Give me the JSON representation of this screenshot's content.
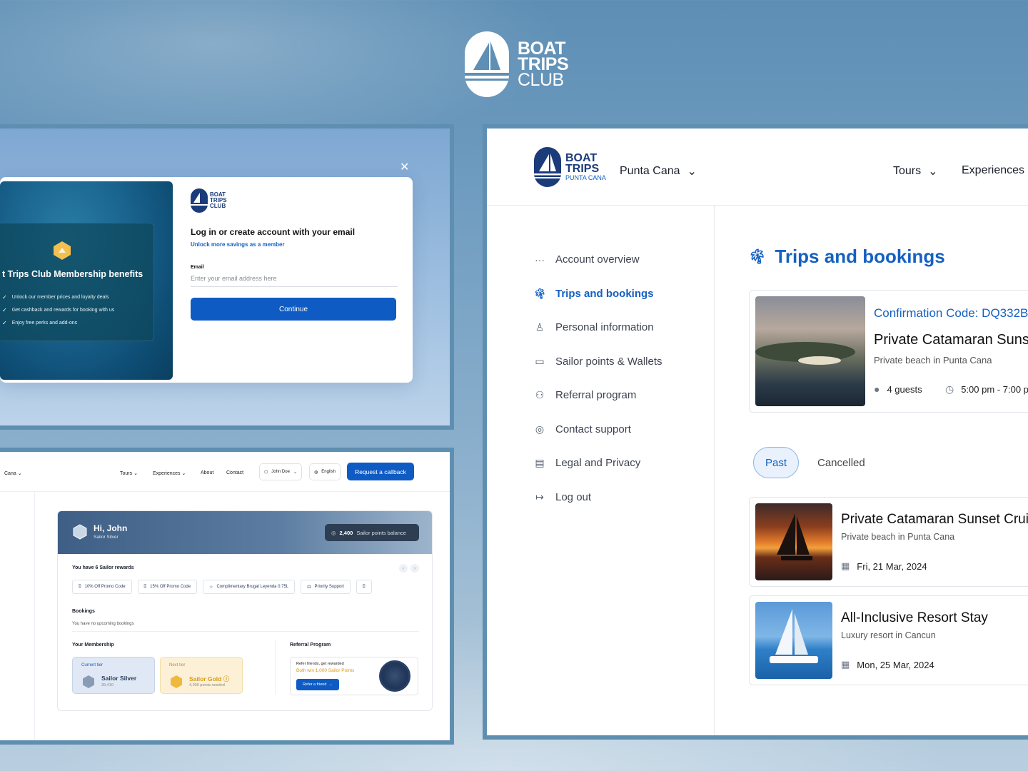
{
  "brand": {
    "hero_line1": "BOAT",
    "hero_line2": "TRIPS",
    "hero_line3": "CLUB",
    "colors": {
      "primary": "#0f5bc4",
      "navy": "#1b3b7a",
      "accent_gold": "#d99a17"
    }
  },
  "login_panel": {
    "close_icon": "close-icon",
    "logo": [
      "BOAT",
      "TRIPS",
      "CLUB"
    ],
    "benefits_title": "t Trips Club Membership benefits",
    "benefits": [
      "Unlock our member prices and loyalty deals",
      "Get cashback and rewards for booking with us",
      "Enjoy free perks and add-ons"
    ],
    "heading": "Log in or create account with your email",
    "subheading": "Unlock more savings as a member",
    "email_label": "Email",
    "email_placeholder": "Enter your email address here",
    "continue_label": "Continue"
  },
  "dashboard_panel": {
    "location": "Cana",
    "nav": {
      "tours": "Tours",
      "experiences": "Experiences",
      "about": "About",
      "contact": "Contact"
    },
    "user": "John Doe",
    "language": "English",
    "callback_label": "Request a callback",
    "greeting": "Hi, John",
    "tier": "Sailor Silver",
    "points_value": "2,400",
    "points_label": "Sailor points balance",
    "rewards_heading": "You have 6 Sailor rewards",
    "rewards": [
      "10% Off Promo Code",
      "15% Off Promo Code",
      "Complimentary Brugal Leyenda 0.75L",
      "Priority Support"
    ],
    "bookings_heading": "Bookings",
    "bookings_empty": "You have no upcoming bookings",
    "membership_heading": "Your Membership",
    "current_tier_label": "Current tier",
    "current_tier_name": "Sailor Silver",
    "current_tier_points": "39,410",
    "next_tier_label": "Next tier",
    "next_tier_name": "Sailor Gold",
    "next_tier_points": "4,300 points needed",
    "referral_heading": "Referral Program",
    "referral_line1": "Refer friends, get rewarded",
    "referral_line2": "Both win 1,000 Sailor Points",
    "referral_button": "Refer a friend"
  },
  "trips_panel": {
    "logo_line1": "BOAT",
    "logo_line2": "TRIPS",
    "logo_sub": "PUNTA CANA",
    "destination": "Punta Cana",
    "nav_tours": "Tours",
    "nav_experiences": "Experiences",
    "menu": [
      {
        "label": "Account overview",
        "icon": "dots-icon"
      },
      {
        "label": "Trips and bookings",
        "icon": "palm-icon"
      },
      {
        "label": "Personal information",
        "icon": "user-icon"
      },
      {
        "label": "Sailor points & Wallets",
        "icon": "wallet-icon"
      },
      {
        "label": "Referral program",
        "icon": "people-icon"
      },
      {
        "label": "Contact support",
        "icon": "lifebuoy-icon"
      },
      {
        "label": "Legal and Privacy",
        "icon": "document-icon"
      },
      {
        "label": "Log out",
        "icon": "logout-icon"
      }
    ],
    "title": "Trips and bookings",
    "upcoming": {
      "confirmation": "Confirmation Code: DQ332B",
      "name": "Private Catamaran Sunse",
      "location": "Private beach in Punta Cana",
      "guests": "4 guests",
      "time": "5:00 pm - 7:00 p"
    },
    "tabs": {
      "past": "Past",
      "cancelled": "Cancelled"
    },
    "past_trips": [
      {
        "name": "Private Catamaran Sunset Crui",
        "location": "Private beach in Punta Cana",
        "date": "Fri, 21 Mar, 2024"
      },
      {
        "name": "All-Inclusive Resort Stay",
        "location": "Luxury resort in Cancun",
        "date": "Mon, 25 Mar, 2024"
      }
    ]
  }
}
